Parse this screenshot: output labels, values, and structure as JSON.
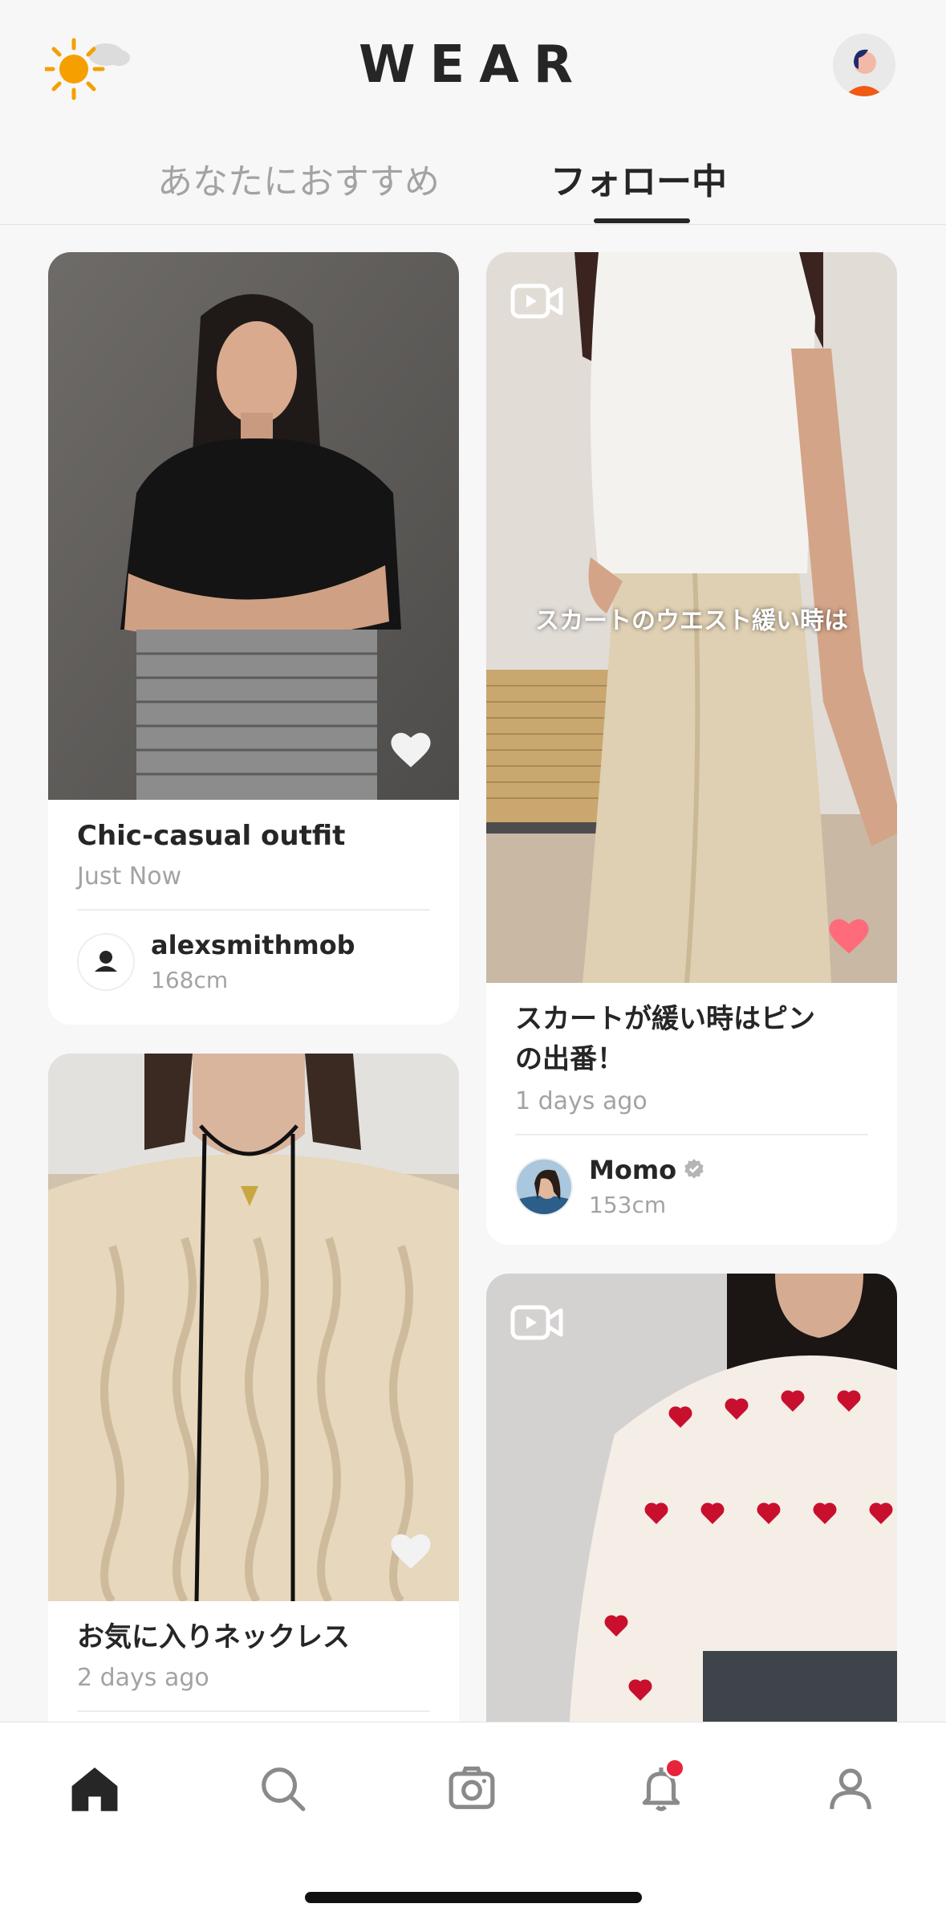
{
  "header": {
    "weather_icon": "sun-cloud-icon",
    "logo": "WEAR",
    "avatar_icon": "user-avatar-icon"
  },
  "tabs": [
    {
      "label": "あなたにおすすめ",
      "active": false
    },
    {
      "label": "フォロー中",
      "active": true
    }
  ],
  "feed": {
    "left": [
      {
        "type": "photo",
        "title": "Chic-casual outfit",
        "time": "Just Now",
        "user": {
          "name": "alexsmithmob",
          "height": "168cm",
          "verified": false
        },
        "liked": false
      },
      {
        "type": "photo",
        "title": "お気に入りネックレス",
        "time": "2 days ago",
        "liked": false
      }
    ],
    "right": [
      {
        "type": "video",
        "overlay": "スカートのウエスト緩い時は",
        "title_line1": "スカートが緩い時はピン",
        "title_line2": "の出番！",
        "time": "1 days ago",
        "user": {
          "name": "Momo",
          "height": "153cm",
          "verified": true
        },
        "liked": true
      },
      {
        "type": "video"
      }
    ]
  },
  "colors": {
    "liked_heart": "#ff6b7a",
    "notification_dot": "#e8243c",
    "accent_text": "#262626"
  },
  "bottom_nav": [
    {
      "icon": "home-icon",
      "active": true
    },
    {
      "icon": "search-icon",
      "active": false
    },
    {
      "icon": "camera-icon",
      "active": false
    },
    {
      "icon": "bell-icon",
      "active": false,
      "badge": true
    },
    {
      "icon": "profile-icon",
      "active": false
    }
  ]
}
